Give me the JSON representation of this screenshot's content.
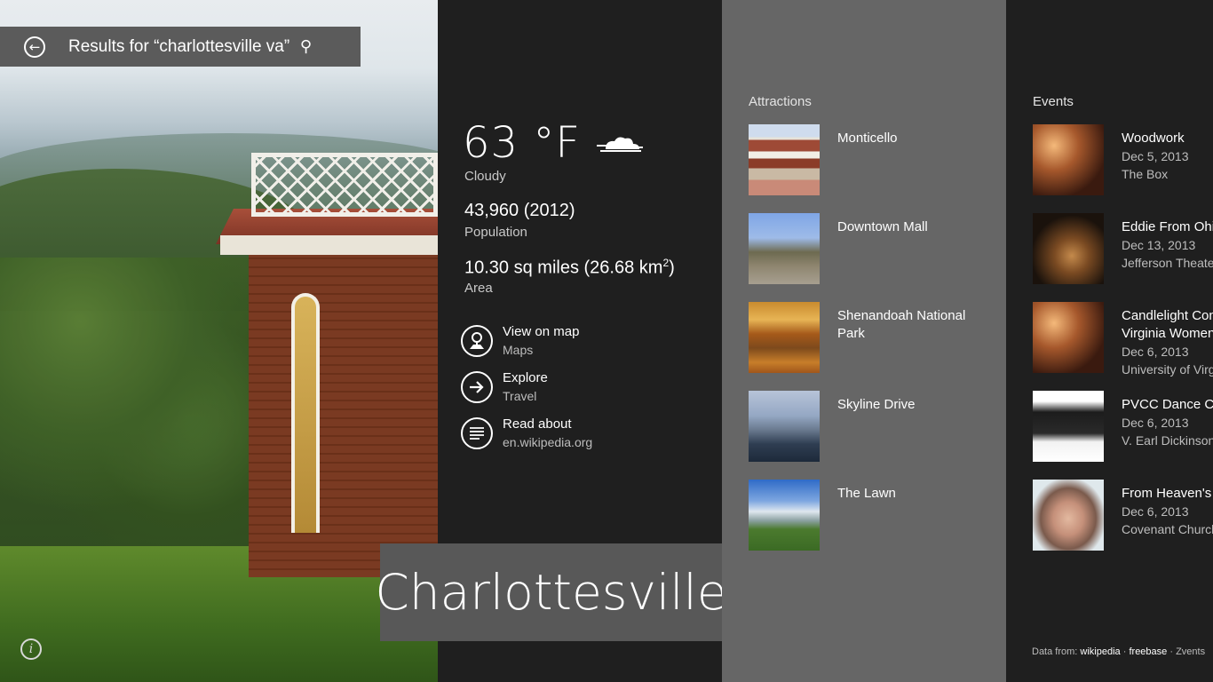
{
  "search": {
    "query": "Results for “charlottesville va”"
  },
  "weather": {
    "temperature": "63 °F",
    "condition": "Cloudy",
    "icon": "cloud-icon"
  },
  "stats": {
    "population_value": "43,960 (2012)",
    "population_label": "Population",
    "area_value": "10.30 sq miles (26.68 km",
    "area_sup": "2",
    "area_close": ")",
    "area_label": "Area"
  },
  "actions": [
    {
      "title": "View on map",
      "subtitle": "Maps",
      "icon": "map-pin-icon"
    },
    {
      "title": "Explore",
      "subtitle": "Travel",
      "icon": "arrow-right-icon"
    },
    {
      "title": "Read about",
      "subtitle": "en.wikipedia.org",
      "icon": "document-lines-icon"
    }
  ],
  "city": "Charlottesville",
  "attractions": {
    "title": "Attractions",
    "items": [
      {
        "name": "Monticello"
      },
      {
        "name": "Downtown Mall"
      },
      {
        "name": "Shenandoah National Park"
      },
      {
        "name": "Skyline Drive"
      },
      {
        "name": "The Lawn"
      }
    ]
  },
  "events": {
    "title": "Events",
    "items": [
      {
        "title": "Woodwork",
        "date": "Dec 5, 2013",
        "venue": "The Box"
      },
      {
        "title": "Eddie From Ohio",
        "date": "Dec 13, 2013",
        "venue": "Jefferson Theater"
      },
      {
        "title": "Candlelight Concert",
        "title2": "Virginia Women",
        "date": "Dec 6, 2013",
        "venue": "University of Virginia"
      },
      {
        "title": "PVCC Dance Concert",
        "date": "Dec 6, 2013",
        "venue": "V. Earl Dickinson"
      },
      {
        "title": "From Heaven's T",
        "date": "Dec 6, 2013",
        "venue": "Covenant Church"
      }
    ]
  },
  "footer": {
    "prefix": "Data from:",
    "source1": "wikipedia",
    "sep": "·",
    "source2": "freebase",
    "source3": "Zvents"
  }
}
